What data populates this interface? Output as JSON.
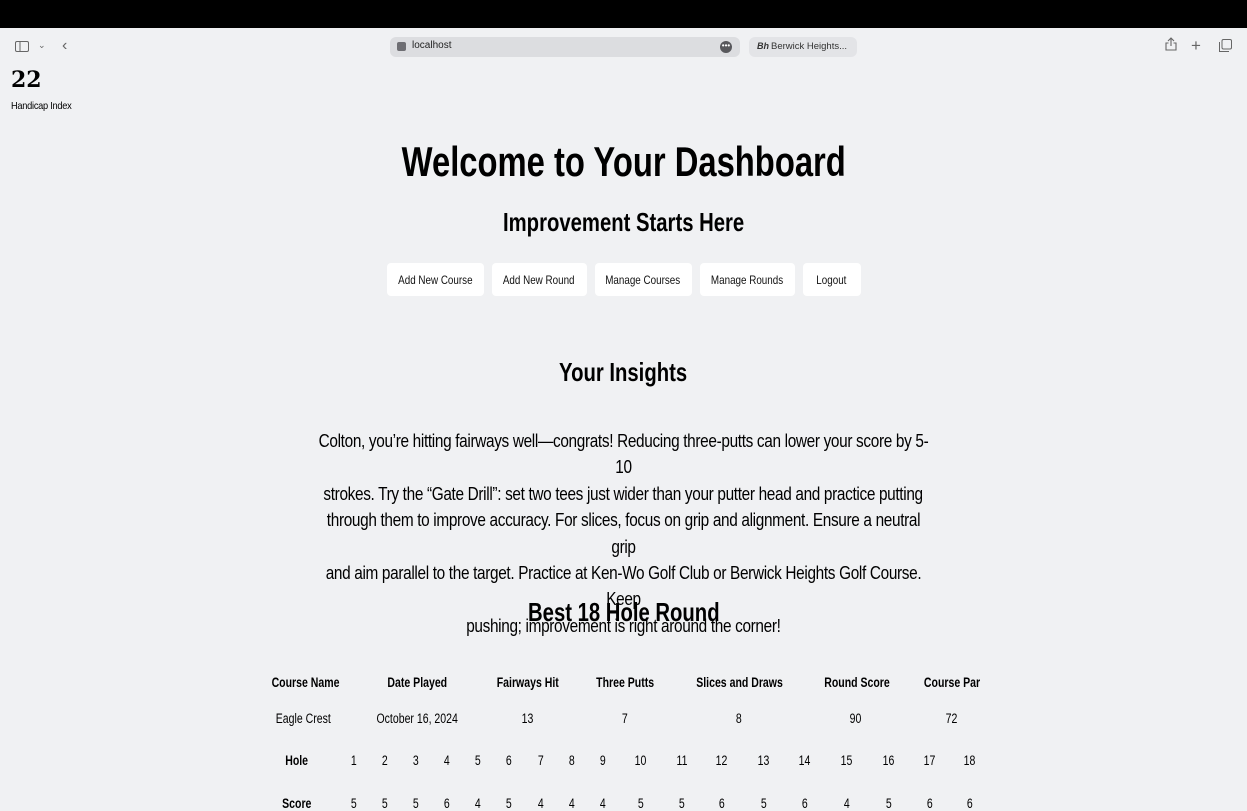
{
  "browser": {
    "url": "localhost",
    "second_tab": "Berwick Heights..."
  },
  "handicap": {
    "value": "22",
    "label": "Handicap Index"
  },
  "header": {
    "title": "Welcome to Your Dashboard",
    "subtitle": "Improvement Starts Here"
  },
  "nav": {
    "buttons": [
      {
        "label": "Add New Course"
      },
      {
        "label": "Add New Round"
      },
      {
        "label": "Manage Courses"
      },
      {
        "label": "Manage Rounds"
      },
      {
        "label": "Logout"
      }
    ]
  },
  "insights": {
    "title": "Your Insights",
    "lines": [
      "Colton, you’re hitting fairways well—congrats! Reducing three-putts can lower your score by 5-10",
      "strokes. Try the “Gate Drill”: set two tees just wider than your putter head and practice putting",
      "through them to improve accuracy. For slices, focus on grip and alignment. Ensure a neutral grip",
      "and aim parallel to the target. Practice at Ken-Wo Golf Club or Berwick Heights Golf Course. Keep",
      "pushing; improvement is right around the corner!"
    ]
  },
  "best_round": {
    "title": "Best 18 Hole Round",
    "summary_headers": [
      "Course Name",
      "Date Played",
      "Fairways Hit",
      "Three Putts",
      "Slices and Draws",
      "Round Score",
      "Course Par"
    ],
    "summary_values": [
      "Eagle Crest",
      "October 16, 2024",
      "13",
      "7",
      "8",
      "90",
      "72"
    ],
    "hole_label": "Hole",
    "holes": [
      "1",
      "2",
      "3",
      "4",
      "5",
      "6",
      "7",
      "8",
      "9",
      "10",
      "11",
      "12",
      "13",
      "14",
      "15",
      "16",
      "17",
      "18"
    ],
    "score_label": "Score",
    "scores": [
      "5",
      "5",
      "5",
      "6",
      "4",
      "5",
      "4",
      "4",
      "4",
      "5",
      "5",
      "6",
      "5",
      "6",
      "4",
      "5",
      "6",
      "6"
    ]
  }
}
